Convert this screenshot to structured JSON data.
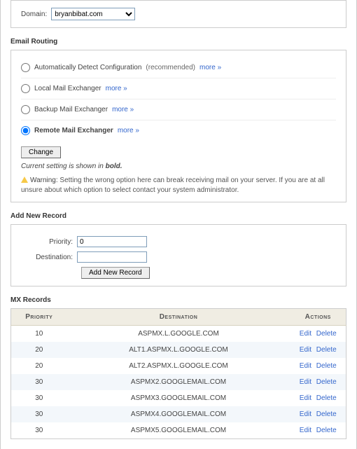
{
  "domain_section": {
    "label": "Domain:",
    "value": "bryanbibat.com"
  },
  "routing": {
    "heading": "Email Routing",
    "options": [
      {
        "label": "Automatically Detect Configuration",
        "suffix": "(recommended)",
        "bold": false,
        "more": "more »",
        "checked": false
      },
      {
        "label": "Local Mail Exchanger",
        "more": "more »",
        "bold": false,
        "checked": false
      },
      {
        "label": "Backup Mail Exchanger",
        "more": "more »",
        "bold": false,
        "checked": false
      },
      {
        "label": "Remote Mail Exchanger",
        "more": "more »",
        "bold": true,
        "checked": true
      }
    ],
    "change_btn": "Change",
    "current_note_prefix": "Current setting is shown in ",
    "current_note_bold": "bold.",
    "warn_label": "Warning:",
    "warn_text": " Setting the wrong option here can break receiving mail on your server. If you are at all unsure about which option to select contact your system administrator."
  },
  "add": {
    "heading": "Add New Record",
    "priority_label": "Priority:",
    "priority_value": "0",
    "dest_label": "Destination:",
    "dest_value": "",
    "submit": "Add New Record"
  },
  "mx": {
    "heading": "MX Records",
    "cols": {
      "priority": "Priority",
      "destination": "Destination",
      "actions": "Actions"
    },
    "action_edit": "Edit",
    "action_delete": "Delete",
    "rows": [
      {
        "priority": "10",
        "dest": "ASPMX.L.GOOGLE.COM"
      },
      {
        "priority": "20",
        "dest": "ALT1.ASPMX.L.GOOGLE.COM"
      },
      {
        "priority": "20",
        "dest": "ALT2.ASPMX.L.GOOGLE.COM"
      },
      {
        "priority": "30",
        "dest": "ASPMX2.GOOGLEMAIL.COM"
      },
      {
        "priority": "30",
        "dest": "ASPMX3.GOOGLEMAIL.COM"
      },
      {
        "priority": "30",
        "dest": "ASPMX4.GOOGLEMAIL.COM"
      },
      {
        "priority": "30",
        "dest": "ASPMX5.GOOGLEMAIL.COM"
      }
    ]
  }
}
